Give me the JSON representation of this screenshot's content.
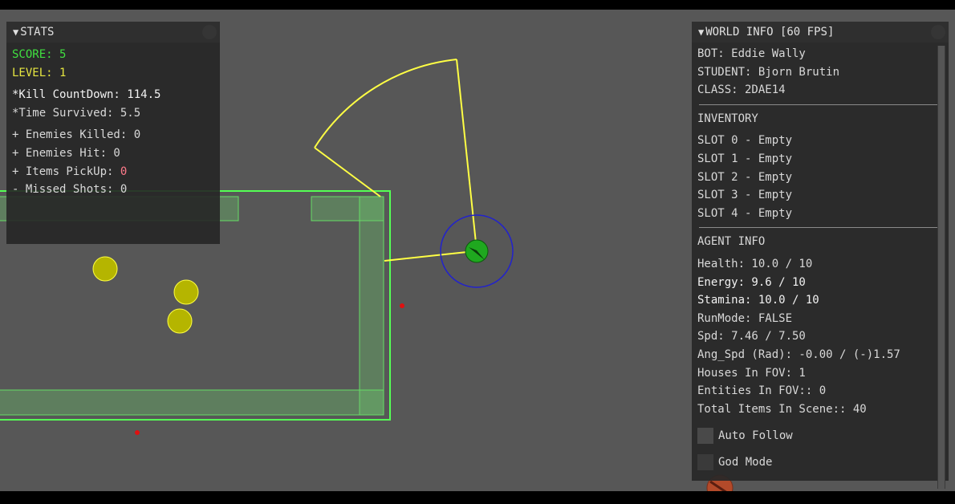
{
  "stats": {
    "title": "STATS",
    "score": "SCORE: 5",
    "level": "LEVEL: 1",
    "kill_countdown": "*Kill CountDown: 114.5",
    "time_survived": "*Time Survived: 5.5",
    "enemies_killed": "+ Enemies Killed: 0",
    "enemies_hit": "+ Enemies Hit: 0",
    "items_pickup_label": "+ Items PickUp: ",
    "items_pickup_value": "0",
    "missed_shots": "- Missed Shots: 0"
  },
  "world": {
    "title": "WORLD INFO [60 FPS]",
    "bot": "BOT: Eddie Wally",
    "student": "STUDENT: Bjorn Brutin",
    "class": "CLASS: 2DAE14",
    "inventory_header": "INVENTORY",
    "slots": [
      "SLOT 0 - Empty",
      "SLOT 1 - Empty",
      "SLOT 2 - Empty",
      "SLOT 3 - Empty",
      "SLOT 4 - Empty"
    ],
    "agent_header": "AGENT INFO",
    "health": "Health: 10.0 / 10",
    "energy": "Energy: 9.6 / 10",
    "stamina": "Stamina: 10.0 / 10",
    "runmode": "RunMode: FALSE",
    "spd": "Spd: 7.46 / 7.50",
    "ang_spd": "Ang_Spd (Rad): -0.00 / (-)1.57",
    "houses_fov": "Houses In FOV: 1",
    "entities_fov": "Entities In FOV:: 0",
    "total_items": "Total Items In Scene:: 40",
    "auto_follow": "Auto Follow",
    "god_mode": "God Mode"
  },
  "colors": {
    "background": "#575757",
    "house_outline": "#55ff55",
    "fov_cone": "#ffff44",
    "agent": "#1fa81f",
    "agent_range": "#2222cc",
    "item": "#b5b500",
    "marker": "#e01010"
  }
}
